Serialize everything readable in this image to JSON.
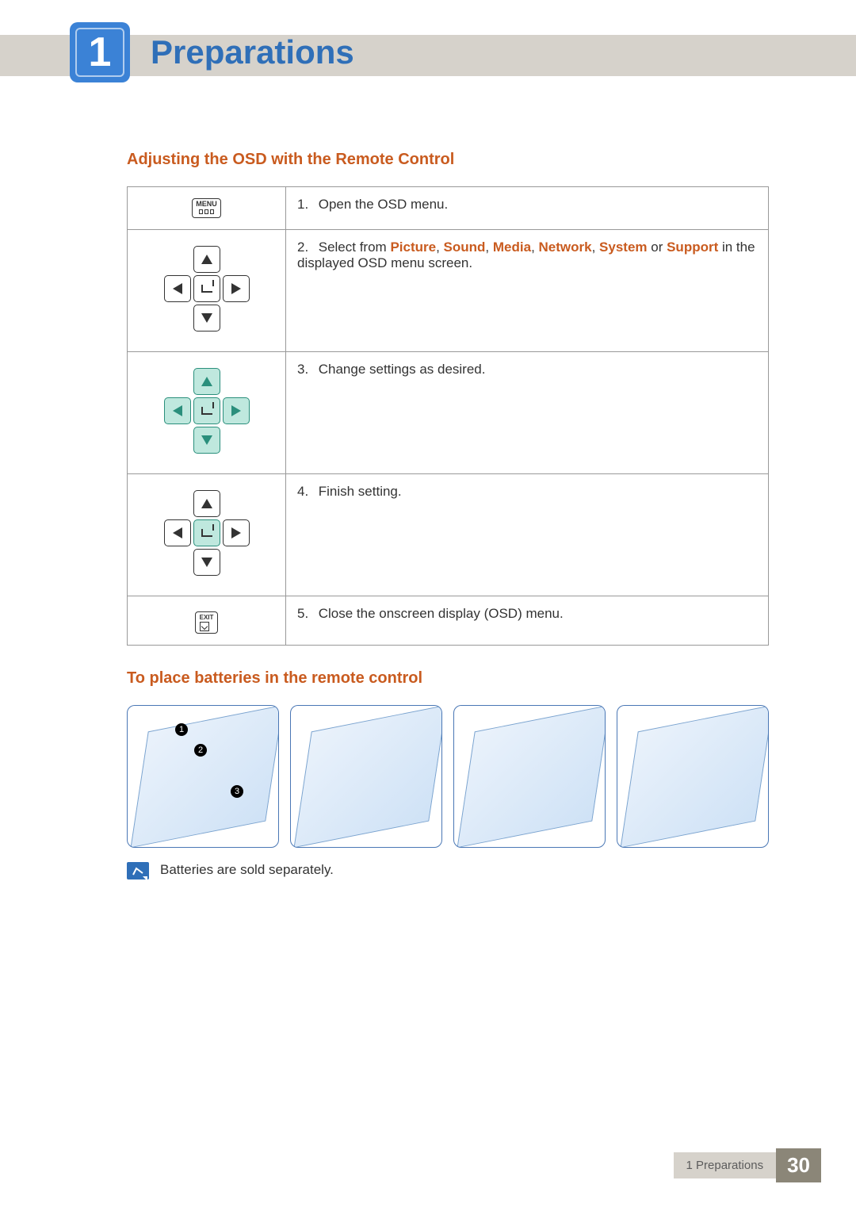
{
  "chapter": {
    "number": "1",
    "title": "Preparations"
  },
  "section1": {
    "heading": "Adjusting the OSD with the Remote Control"
  },
  "steps": {
    "s1": {
      "num": "1.",
      "text": "Open the OSD menu."
    },
    "s2": {
      "num": "2.",
      "pre": "Select from ",
      "opt1": "Picture",
      "sep1": ", ",
      "opt2": "Sound",
      "sep2": ", ",
      "opt3": "Media",
      "sep3": ", ",
      "opt4": "Network",
      "sep4": ", ",
      "opt5": "System",
      "sep5": " or ",
      "opt6": "Support",
      "post": " in the displayed OSD menu screen."
    },
    "s3": {
      "num": "3.",
      "text": "Change settings as desired."
    },
    "s4": {
      "num": "4.",
      "text": "Finish setting."
    },
    "s5": {
      "num": "5.",
      "text": "Close the onscreen display (OSD) menu."
    }
  },
  "icons": {
    "menu_label": "MENU",
    "exit_label": "EXIT"
  },
  "section2": {
    "heading": "To place batteries in the remote control"
  },
  "callouts": {
    "c1": "1",
    "c2": "2",
    "c3": "3"
  },
  "note": {
    "text": "Batteries are sold separately."
  },
  "footer": {
    "label": "1 Preparations",
    "page": "30"
  }
}
